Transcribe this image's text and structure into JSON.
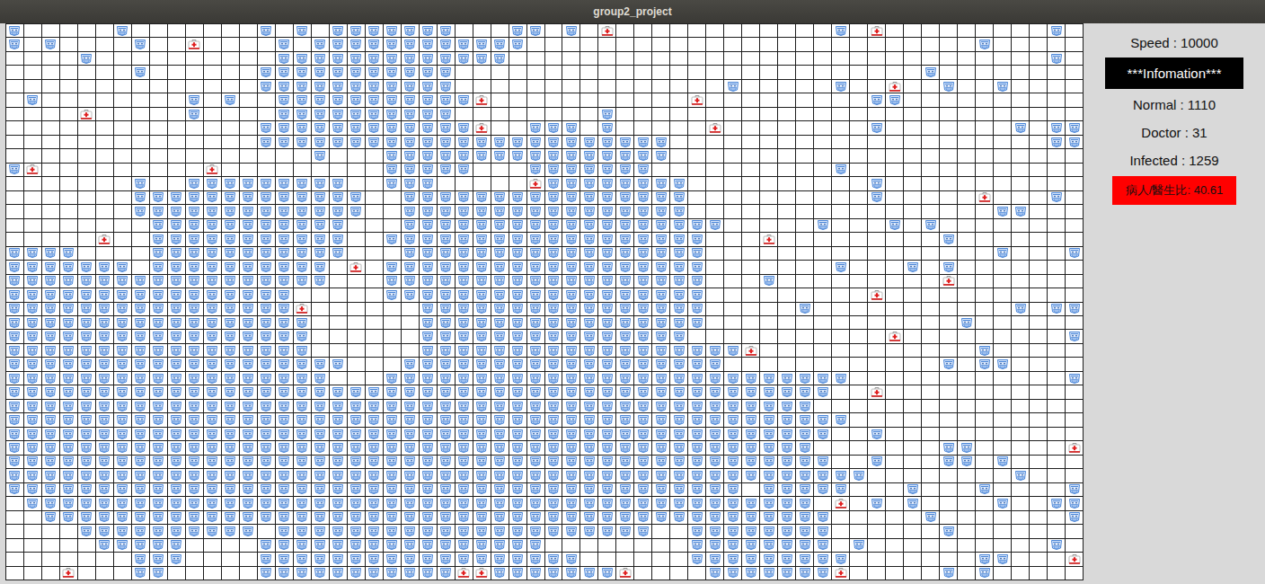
{
  "window": {
    "title": "group2_project"
  },
  "grid": {
    "rows": [
      "I.....I.......I.I.IIIIIII...II.I.D............I.D.........I",
      "I.I....I..D....I.IIIIIIIIIIII.........................I......I",
      "....I..........IIIIIIIIIIIII..............................I......II...D",
      ".......I......IIIIIIIIIII..........................I..........",
      "..............IIIIIIIIIII...............I.....I..D..I..I........",
      ".I........I.I..IIIIIIIIIIID...........D.........II...........",
      "....D.....I....IIIIIIIIII........I..........................",
      "..............IIIIIIIIIIIID..III.I.....D........I.......I.II",
      "..............IIIIIIIIIIIIIIIIIIIIIII.....................III....",
      ".................I...IIIIIIIIIIIIIIII.......................II.I",
      "ID.........D.........IIIII...IIIIIII..........I.............",
      ".......I..IIIIIIIII..III.....DIIIIIIII..........I...........",
      ".......IIIIIIIIIIIII..IIIIIIIIIIIIIIII..........I.....D...I.",
      ".......IIIIIIIIIIIII..IIIIIIIIIIIIIIII.................II.",
      "........IIIIIIIIIII...IIIIIIIIIIIIIIIIII.....I...I.I........",
      ".....D..IIIIIIIIIII..IIIIIIIIIIIIIIIIII...D.........I......",
      "IIII....IIIIIIIIIII...IIIIIIIIIIIIIIIII................I...I..",
      "IIIIIII.IIIIIIIIII.D.IIIIIIIIIIIIIIIIII.......I...I.I.......",
      "IIIIIIIIIIIIIIIIII...IIIIIIIIIIIIIIIIII...I.........D.....",
      "IIIIIIIIIIIIIIII.....IIIIIIIIIIIIIIIIII.........D...........",
      "IIIIIIIIIIIIIIIID......IIIIIIIIIIIIIIII.....I...........I.II",
      "IIIIIIIIIIIIIIIII......IIIIIIIIIIIIIIII..............I......",
      "IIIIIIIIIIIIIIIII......IIIIIIIIIIIIIII...........D.........I",
      "IIIIIIIIIIIIIIIII......IIIIIIIIIIIIIIIIIID............I.....",
      "IIIIIIIIIIIIIIIIIII...IIIIIIIIIIIIIIIIII............I.II....",
      "IIIIIIIIIIIIIIIIII...IIIIIIIIIIIIIIIIIIIIIIIIII............I",
      "IIIIIIIIIIIIIIIIIIIIIIIIIIIIIIIIIIIIIIIIIIIIII..D...........",
      "IIIIIIIIIIIIIIIIIIIIIIIIIIIIIIIIIIIIIIIIIIIII...............",
      "IIIIIIIIIIIIIIIIIIIIIIIIIIIIIIIIIIIIIIIIIIIIIII.............",
      "IIIIIIIIIIIIIIIIIIIIIIIIIIIIIIIIIIIIIIIIIIIIII..I...........",
      "IIIIIIIIIIIIIIIIIIIIIIIIIIIIIIIIIIIIIIIIIIIII.......II.....D",
      "IIIIIIIIIIIIIIIIIIIIIIIIIIIIIIIIIIIIIIIIIIIIII..I...II.I....",
      "IIIIIIIIIIIIIIIIIIIIIIIIIIIIIIIIIIIIIIIIIIIIIIII........I...",
      "IIIIIIIIIIIIIIIIIIIIIIIIIIIIIIIIIIIIIIIII.IIIII...I...I....I",
      ".IIIIIIIIIIIIIIIIIIIIIIIIIIIIIIIIIIIIIIIIIIII.D.I.I....I..II",
      "..IIIIIIIIIIIIIIIIIIIIIIIIIIIIIIIIIIIIIIIIIIII.....I.......I",
      "....IIIIIIIIII.IIIIIIIIIIIIIIIIIIIII..IIIIIIII......I.......",
      ".....IIIII....IIIIIIIIIIIIIIII........IIIIIIII.I..........I.",
      ".......III....IIIIIIIIIIIIIIIIII......IIIIIIIII.......II...D",
      "...D...II.....IIIIIIIIIIIDDIIIIIIID....IIIIIIID.....I.I......"
    ]
  },
  "panel": {
    "speed": "Speed : 10000",
    "header": "***Infomation***",
    "normal": "Normal : 1110",
    "doctor": "Doctor : 31",
    "infected": "Infected : 1259",
    "ratio": "病人/醫生比: 40.61"
  }
}
